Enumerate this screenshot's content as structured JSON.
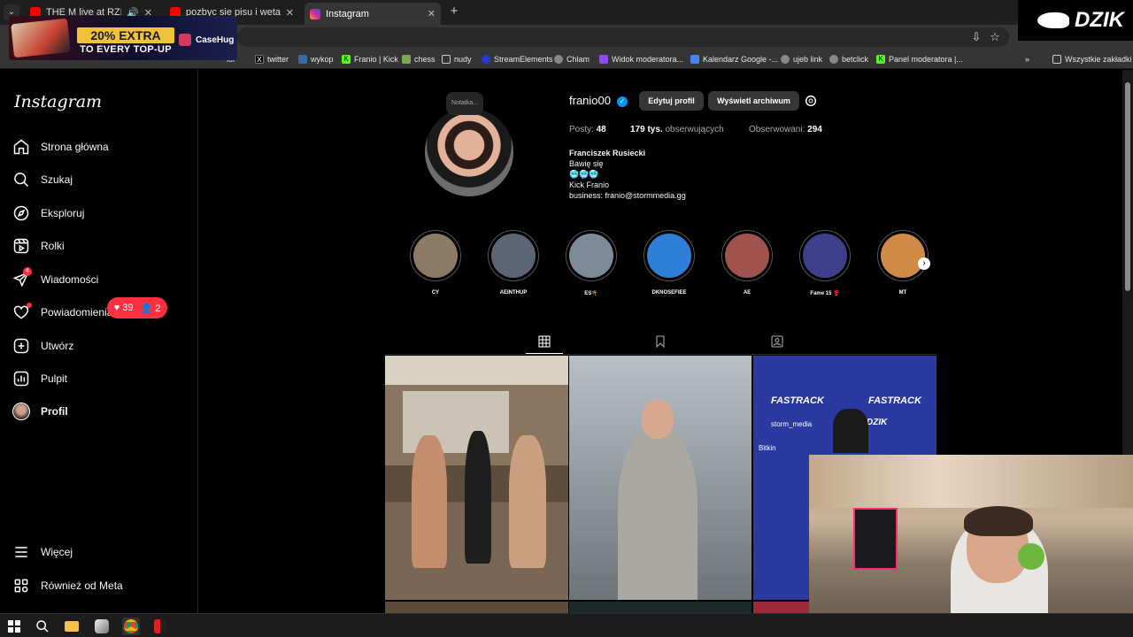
{
  "browser": {
    "tabs": [
      {
        "title": "THE M live at RZESZOWSKI",
        "favicon": "youtube-icon",
        "active": false
      },
      {
        "title": "pozbyc sie pisu i weta prezydenta",
        "favicon": "youtube-icon",
        "active": false
      },
      {
        "title": "Instagram",
        "favicon": "instagram-icon",
        "active": true
      }
    ],
    "bookmarks": [
      {
        "label": "ior"
      },
      {
        "label": "twitter"
      },
      {
        "label": "wykop"
      },
      {
        "label": "Franio | Kick"
      },
      {
        "label": "chess"
      },
      {
        "label": "nudy"
      },
      {
        "label": "StreamElements"
      },
      {
        "label": "Chlam"
      },
      {
        "label": "Widok moderatora..."
      },
      {
        "label": "Kalendarz Google -..."
      },
      {
        "label": "ujeb link"
      },
      {
        "label": "betclick"
      },
      {
        "label": "Panel moderatora |..."
      }
    ],
    "all_bookmarks": "Wszystkie zakładki",
    "chevron": "»"
  },
  "ad": {
    "headline": "20% EXTRA",
    "subline": "TO EVERY TOP-UP",
    "brand": "CaseHug"
  },
  "overlay": {
    "logo": "DZIK"
  },
  "instagram": {
    "logo": "Instagram",
    "nav": [
      {
        "label": "Strona główna",
        "icon": "home-icon"
      },
      {
        "label": "Szukaj",
        "icon": "search-icon"
      },
      {
        "label": "Eksploruj",
        "icon": "compass-icon"
      },
      {
        "label": "Rolki",
        "icon": "reels-icon"
      },
      {
        "label": "Wiadomości",
        "icon": "messages-icon",
        "badge": "4"
      },
      {
        "label": "Powiadomienia",
        "icon": "heart-icon"
      },
      {
        "label": "Utwórz",
        "icon": "plus-square-icon"
      },
      {
        "label": "Pulpit",
        "icon": "dashboard-icon"
      },
      {
        "label": "Profil",
        "icon": "avatar"
      }
    ],
    "nav_bottom": [
      {
        "label": "Więcej",
        "icon": "menu-icon"
      },
      {
        "label": "Również od Meta",
        "icon": "meta-icon"
      }
    ],
    "notifications": {
      "likes": "39",
      "followers": "2"
    },
    "profile": {
      "note": "Notatka...",
      "username": "franio00",
      "edit_button": "Edytuj profil",
      "archive_button": "Wyświetl archiwum",
      "stats": {
        "posts_label": "Posty:",
        "posts": "48",
        "followers": "179 tys.",
        "followers_label": "obserwujących",
        "following_label": "Obserwowani:",
        "following": "294"
      },
      "bio": {
        "name": "Franciszek Rusiecki",
        "line1": "Bawię się",
        "emoji": "🥶🥶🥶",
        "line2": "Kick Franio",
        "line3": "business: franio@stormmedia.gg"
      }
    },
    "highlights": [
      {
        "label": "CY",
        "color": "#8a7a66"
      },
      {
        "label": "AEINTHUP",
        "color": "#5b6573"
      },
      {
        "label": "ES🌴",
        "color": "#7d8b99"
      },
      {
        "label": "DKNOSEFIEE",
        "color": "#2f7fd8"
      },
      {
        "label": "AE",
        "color": "#a0524f"
      },
      {
        "label": "Fame 15 🥊",
        "color": "#3d3f8a"
      },
      {
        "label": "MT",
        "color": "#d08a48"
      }
    ],
    "tabs": [
      "posts-grid-icon",
      "saved-icon",
      "tagged-icon"
    ],
    "posts": [
      {
        "alt": "sumo",
        "color": "#6a5a48"
      },
      {
        "alt": "portrait",
        "color": "#9aa4ad"
      },
      {
        "alt": "fastrack",
        "color": "#2a3aa0",
        "texts": [
          "FASTRACK",
          "DZIK",
          "storm_media",
          "Bitkin"
        ]
      }
    ]
  }
}
